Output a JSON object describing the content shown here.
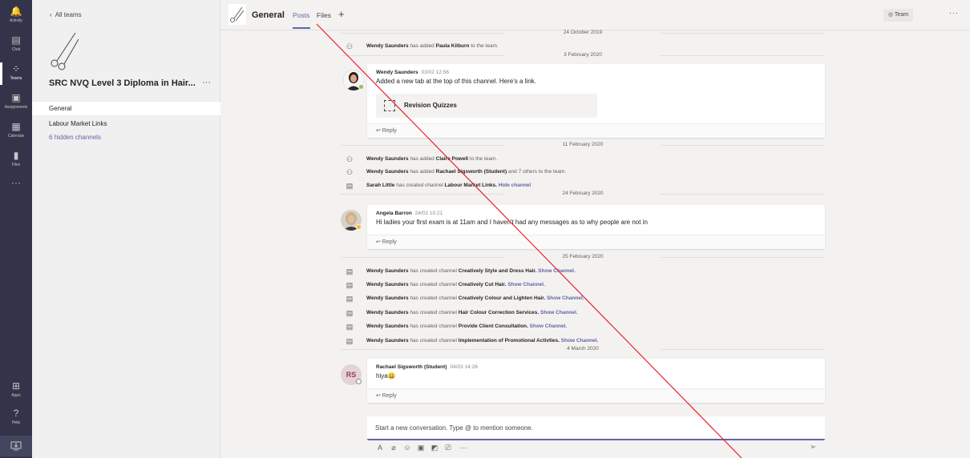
{
  "appbar": {
    "items": [
      {
        "label": "Activity",
        "icon": "bell-icon",
        "glyph": "🔔"
      },
      {
        "label": "Chat",
        "icon": "chat-icon",
        "glyph": "▤"
      },
      {
        "label": "Teams",
        "icon": "teams-icon",
        "glyph": "⁘",
        "active": true
      },
      {
        "label": "Assignments",
        "icon": "assignments-icon",
        "glyph": "▣"
      },
      {
        "label": "Calendar",
        "icon": "calendar-icon",
        "glyph": "▦"
      },
      {
        "label": "Files",
        "icon": "files-icon",
        "glyph": "▮"
      },
      {
        "label": "",
        "icon": "more-apps-icon",
        "glyph": "···"
      }
    ],
    "bottom": [
      {
        "label": "Apps",
        "icon": "apps-icon",
        "glyph": "⊞"
      },
      {
        "label": "Help",
        "icon": "help-icon",
        "glyph": "?"
      }
    ],
    "download_icon": "download-icon"
  },
  "teampanel": {
    "back_label": "All teams",
    "team_name": "SRC NVQ Level 3 Diploma in Hair...",
    "more": "···",
    "channels": [
      {
        "label": "General",
        "selected": true
      },
      {
        "label": "Labour Market Links"
      }
    ],
    "hidden_channels": "6 hidden channels"
  },
  "header": {
    "channel_title": "General",
    "tabs": {
      "posts": "Posts",
      "files": "Files",
      "add": "+"
    },
    "team_button": "◎ Team",
    "more": "···"
  },
  "feed": {
    "date_top": "24 October 2019",
    "ev_paula": {
      "actor": "Wendy Saunders",
      "verb": "has added",
      "target": "Paula Kilburn",
      "rest": "to the team."
    },
    "date_feb3": "3 February 2020",
    "post1": {
      "author": "Wendy Saunders",
      "time": "03/02 12:56",
      "body": "Added a new tab at the top of this channel. Here's a link.",
      "card_title": "Revision Quizzes",
      "reply": "↩ Reply"
    },
    "date_feb11": "11 February 2020",
    "ev_claire": {
      "actor": "Wendy Saunders",
      "verb": "has added",
      "target": "Claire Powell",
      "rest": "to the team."
    },
    "ev_rachael": {
      "actor": "Wendy Saunders",
      "verb": "has added",
      "target": "Rachael Sigsworth (Student)",
      "rest": "and 7 others to the team."
    },
    "ev_sarah": {
      "actor": "Sarah Little",
      "verb": "has created channel",
      "target": "Labour Market Links.",
      "link": "Hide channel"
    },
    "date_feb24": "24 February 2020",
    "post2": {
      "author": "Angela Barron",
      "time": "24/02 10:21",
      "body": "Hi ladies your first exam is at 11am and I haven't had any messages as to why people are not in",
      "reply": "↩ Reply"
    },
    "date_feb25": "25 February 2020",
    "channel_events": [
      {
        "actor": "Wendy Saunders",
        "verb": "has created channel",
        "target": "Creatively Style and Dress Hair.",
        "link": "Show Channel."
      },
      {
        "actor": "Wendy Saunders",
        "verb": "has created channel",
        "target": "Creatively Cut Hair.",
        "link": "Show Channel."
      },
      {
        "actor": "Wendy Saunders",
        "verb": "has created channel",
        "target": "Creatively Colour and Lighten Hair.",
        "link": "Show Channel."
      },
      {
        "actor": "Wendy Saunders",
        "verb": "has created channel",
        "target": "Hair Colour Correction Services.",
        "link": "Show Channel."
      },
      {
        "actor": "Wendy Saunders",
        "verb": "has created channel",
        "target": "Provide Client Consultation.",
        "link": "Show Channel."
      },
      {
        "actor": "Wendy Saunders",
        "verb": "has created channel",
        "target": "Implementation of Promotional Activties.",
        "link": "Show Channel."
      }
    ],
    "date_mar4": "4 March 2020",
    "post3": {
      "author": "Rachael Sigsworth (Student)",
      "time": "04/03 14:26",
      "initials": "RS",
      "body": "hiya",
      "emoji": "😀",
      "reply": "↩ Reply"
    }
  },
  "composer": {
    "placeholder": "Start a new conversation. Type @ to mention someone.",
    "tools": [
      {
        "icon": "format-icon",
        "glyph": "A"
      },
      {
        "icon": "attach-icon",
        "glyph": "⌀"
      },
      {
        "icon": "emoji-icon",
        "glyph": "☺"
      },
      {
        "icon": "gif-icon",
        "glyph": "▣"
      },
      {
        "icon": "sticker-icon",
        "glyph": "◩"
      },
      {
        "icon": "meet-now-icon",
        "glyph": "⎚"
      },
      {
        "icon": "more-options-icon",
        "glyph": "···"
      }
    ],
    "send_glyph": "➢"
  },
  "colors": {
    "accent": "#6264a7",
    "appbar": "#33344a",
    "annotation": "#e8202a"
  }
}
